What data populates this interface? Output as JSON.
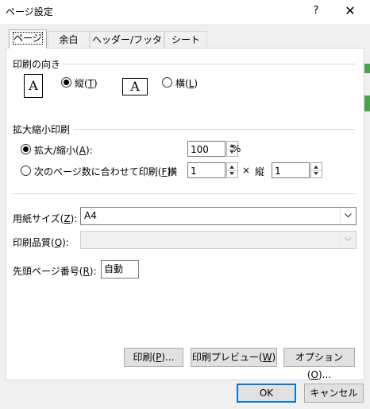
{
  "window": {
    "title": "ページ設定",
    "help": "?",
    "close": "✕"
  },
  "tabs": [
    {
      "label": "ページ",
      "active": true
    },
    {
      "label": "余白",
      "active": false
    },
    {
      "label": "ヘッダー/フッター",
      "active": false
    },
    {
      "label": "シート",
      "active": false
    }
  ],
  "orientation": {
    "label": "印刷の向き",
    "portrait_icon_glyph": "A",
    "portrait_text": "縦(",
    "portrait_key": "T",
    "portrait_end": ")",
    "landscape_icon_glyph": "A",
    "landscape_text": "横(",
    "landscape_key": "L",
    "landscape_end": ")",
    "selected": "portrait"
  },
  "scaling": {
    "label": "拡大縮小印刷",
    "adjust_text": "拡大/縮小(",
    "adjust_key": "A",
    "adjust_end": "):",
    "adjust_value": "100",
    "adjust_unit": "%",
    "fit_text": "次のページ数に合わせて印刷(",
    "fit_key": "F",
    "fit_end": "):",
    "wide_label": "横",
    "wide_value": "1",
    "times": "×",
    "tall_label": "縦",
    "tall_value": "1",
    "selected": "adjust"
  },
  "paper_size": {
    "label_text": "用紙サイズ(",
    "label_key": "Z",
    "label_end": "):",
    "value": "A4"
  },
  "print_quality": {
    "label_text": "印刷品質(",
    "label_key": "Q",
    "label_end": "):",
    "value": ""
  },
  "first_page": {
    "label_text": "先頭ページ番号(",
    "label_key": "R",
    "label_end": "):",
    "value": "自動"
  },
  "panel_buttons": {
    "print": {
      "text": "印刷(",
      "key": "P",
      "end": ")..."
    },
    "preview": {
      "text": "印刷プレビュー(",
      "key": "W",
      "end": ")"
    },
    "options": {
      "text": "オプション(",
      "key": "O",
      "end": ")..."
    }
  },
  "footer_buttons": {
    "ok": "OK",
    "cancel": "キャンセル"
  },
  "colors": {
    "green_strip": "#4aa34a",
    "accent": "#0078d7"
  }
}
